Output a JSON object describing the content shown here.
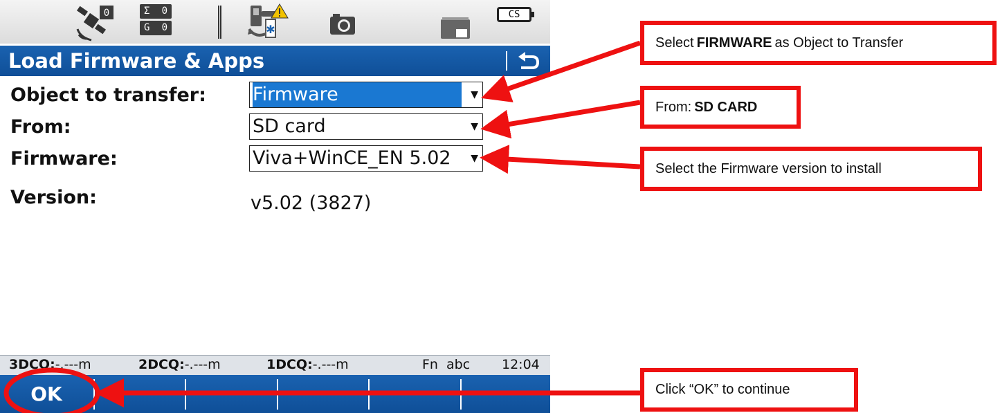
{
  "status_bar": {
    "sigma_label": "Σ",
    "sigma_value": "0",
    "g_label": "G",
    "g_value": "0",
    "sat_count": "0",
    "cs_badge": "CS",
    "icons": [
      "satellite-icon",
      "rover-bluetooth-warning-icon",
      "camera-icon",
      "sd-card-icon",
      "cs-badge-icon"
    ]
  },
  "title": {
    "text": "Load Firmware & Apps",
    "back_icon": "back-arrow-icon"
  },
  "form": {
    "object_label": "Object to transfer:",
    "object_value": "Firmware",
    "from_label": "From:",
    "from_value": "SD card",
    "firmware_label": "Firmware:",
    "firmware_value": "Viva+WinCE_EN 5.02",
    "version_label": "Version:",
    "version_value": "v5.02 (3827)"
  },
  "info_bar": {
    "q3_label": "3DCQ:",
    "q3_value": "-.---m",
    "q2_label": "2DCQ:",
    "q2_value": "-.---m",
    "q1_label": "1DCQ:",
    "q1_value": "-.---m",
    "fn": "Fn",
    "abc": "abc",
    "time": "12:04"
  },
  "softkeys": {
    "ok_label": "OK"
  },
  "annotations": {
    "callout1_pre": "Select",
    "callout1_bold": "FIRMWARE",
    "callout1_post": "as Object to Transfer",
    "callout2_pre": "From:",
    "callout2_bold": "SD CARD",
    "callout3": "Select the Firmware version to install",
    "callout4": "Click “OK” to continue",
    "accent_color": "#ee1111"
  },
  "colors": {
    "bar_blue": "#145aa5",
    "highlight_blue": "#1a78d2"
  }
}
